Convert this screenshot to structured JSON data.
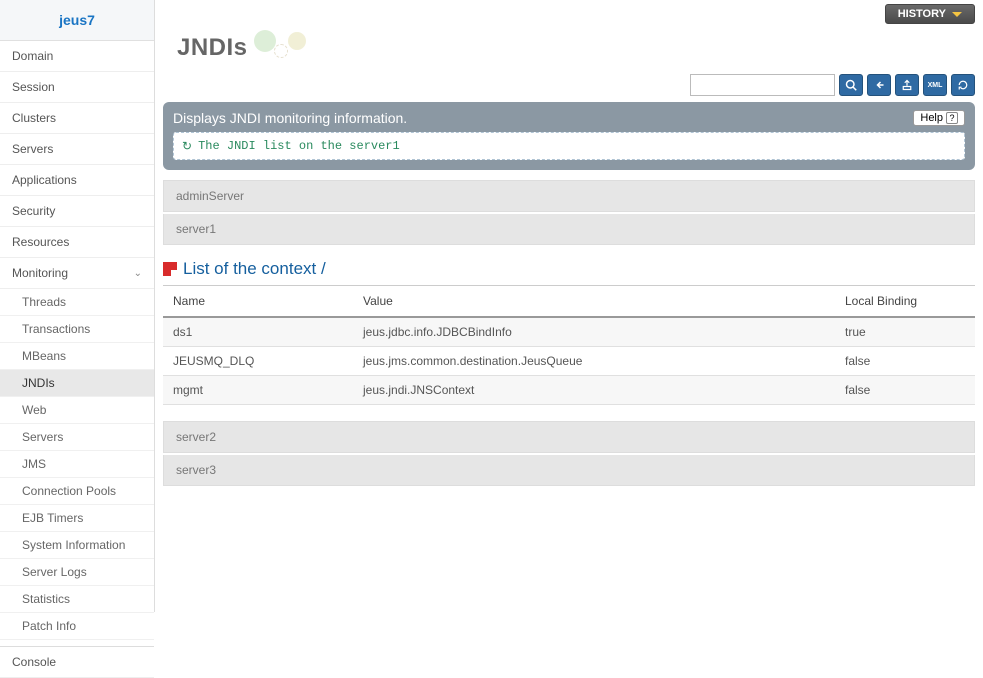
{
  "brand": "jeus7",
  "nav": {
    "top": [
      "Domain",
      "Session",
      "Clusters",
      "Servers",
      "Applications",
      "Security",
      "Resources"
    ],
    "monitoring_label": "Monitoring",
    "sub": [
      "Threads",
      "Transactions",
      "MBeans",
      "JNDIs",
      "Web",
      "Servers",
      "JMS",
      "Connection Pools",
      "EJB Timers",
      "System Information",
      "Server Logs",
      "Statistics",
      "Patch Info"
    ],
    "active_sub": "JNDIs",
    "console": "Console"
  },
  "header": {
    "history": "HISTORY",
    "title": "JNDIs",
    "search_placeholder": ""
  },
  "info": {
    "title": "Displays JNDI monitoring information.",
    "help": "Help",
    "message": "The JNDI list on the server1"
  },
  "servers_top": [
    "adminServer",
    "server1"
  ],
  "context": {
    "title": "List of the context /",
    "columns": [
      "Name",
      "Value",
      "Local Binding"
    ],
    "rows": [
      {
        "name": "ds1",
        "value": "jeus.jdbc.info.JDBCBindInfo",
        "binding": "true"
      },
      {
        "name": "JEUSMQ_DLQ",
        "value": "jeus.jms.common.destination.JeusQueue",
        "binding": "false"
      },
      {
        "name": "mgmt",
        "value": "jeus.jndi.JNSContext",
        "binding": "false"
      }
    ]
  },
  "servers_bottom": [
    "server2",
    "server3"
  ],
  "icons": {
    "search": "search-icon",
    "back": "back-icon",
    "export": "export-icon",
    "xml": "xml-icon",
    "help_q": "?"
  }
}
